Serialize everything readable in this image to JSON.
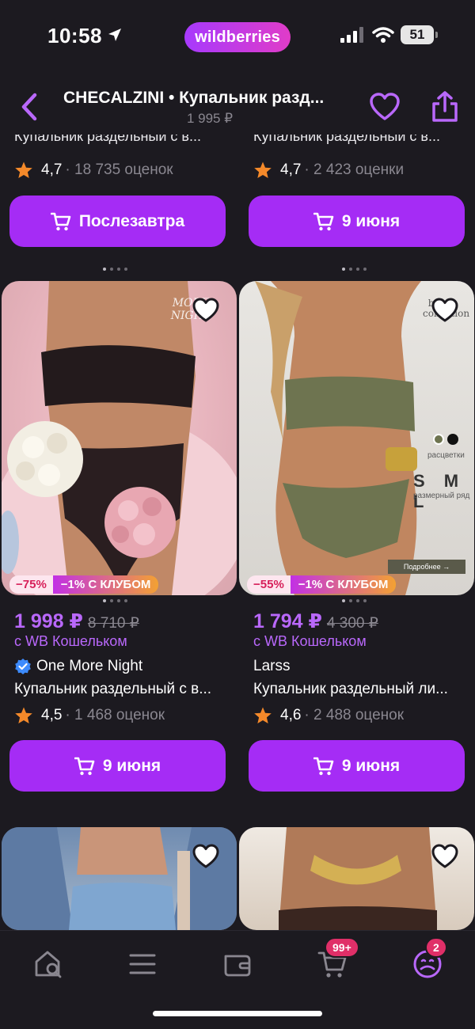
{
  "status": {
    "time": "10:58",
    "battery": "51"
  },
  "brand_pill": "wildberries",
  "header": {
    "title": "CHECALZINI • Купальник разд...",
    "subtitle": "1 995 ₽"
  },
  "top_row": [
    {
      "name": "Купальник раздельный с в...",
      "rating": "4,7",
      "reviews": "· 18 735 оценок",
      "button": "Послезавтра"
    },
    {
      "name": "Купальник раздельный с в...",
      "rating": "4,7",
      "reviews": "· 2 423 оценки",
      "button": "9 июня"
    }
  ],
  "products": [
    {
      "brand_mark": "MORE NIGHT",
      "discount": "−75%",
      "club": "−1% С КЛУБОМ",
      "price": "1 998 ₽",
      "old_price": "8 710 ₽",
      "wallet": "с WB Кошельком",
      "brand": "One More Night",
      "name": "Купальник раздельный с в...",
      "rating": "4,5",
      "reviews": "· 1 468 оценок",
      "button": "9 июня"
    },
    {
      "brand_mark": "beach collection",
      "extra": {
        "colors_label": "расцветки",
        "sizes": "S M L",
        "sizes_label": "размерный ряд",
        "more": "Подробнее →"
      },
      "discount": "−55%",
      "club": "−1% С КЛУБОМ",
      "price": "1 794 ₽",
      "old_price": "4 300 ₽",
      "wallet": "с WB Кошельком",
      "brand": "Larss",
      "name": "Купальник раздельный ли...",
      "rating": "4,6",
      "reviews": "· 2 488 оценок",
      "button": "9 июня"
    }
  ],
  "tabbar": {
    "cart_badge": "99+",
    "profile_badge": "2"
  },
  "colors": {
    "accent": "#a52cf5",
    "price": "#b968fb",
    "background": "#1c1a20",
    "star": "#f4892a",
    "badge": "#e02f68"
  },
  "icons": [
    "location-arrow-icon",
    "signal-icon",
    "wifi-icon",
    "battery-icon",
    "back-chevron-icon",
    "heart-icon",
    "share-icon",
    "star-icon",
    "cart-icon",
    "verified-icon",
    "home-search-icon",
    "catalog-menu-icon",
    "wallet-icon",
    "cart-tab-icon",
    "profile-icon"
  ]
}
